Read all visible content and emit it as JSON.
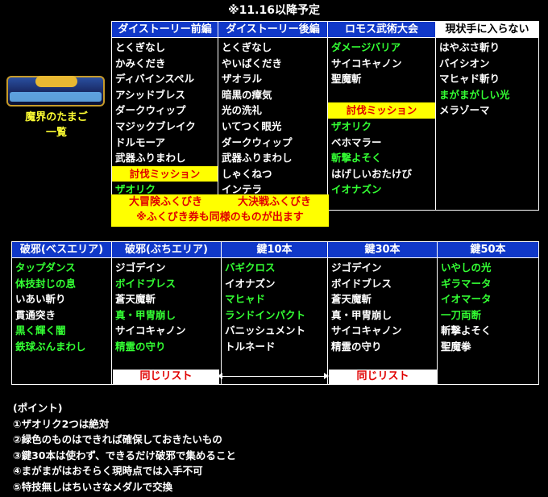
{
  "top_title": "※11.16以降予定",
  "egg_label": [
    "魔界のたまご",
    "一覧"
  ],
  "top_table": {
    "columns": [
      {
        "header": "ダイストーリー前編",
        "header_style": "blue",
        "items": [
          {
            "text": "とくぎなし",
            "c": "w"
          },
          {
            "text": "かみくだき",
            "c": "w"
          },
          {
            "text": "ディバインスペル",
            "c": "w"
          },
          {
            "text": "アシッドブレス",
            "c": "w"
          },
          {
            "text": "ダークウィップ",
            "c": "w"
          },
          {
            "text": "マジックブレイク",
            "c": "w"
          },
          {
            "text": "ドルモーア",
            "c": "w"
          },
          {
            "text": "武器ふりまわし",
            "c": "w"
          },
          {
            "text": "討伐ミッション",
            "c": "bar"
          },
          {
            "text": "ザオリク",
            "c": "g"
          }
        ]
      },
      {
        "header": "ダイストーリー後編",
        "header_style": "blue",
        "items": [
          {
            "text": "とくぎなし",
            "c": "w"
          },
          {
            "text": "やいばくだき",
            "c": "w"
          },
          {
            "text": "ザオラル",
            "c": "w"
          },
          {
            "text": "暗黒の瘴気",
            "c": "w"
          },
          {
            "text": "光の洗礼",
            "c": "w"
          },
          {
            "text": "いてつく眼光",
            "c": "w"
          },
          {
            "text": "ダークウィップ",
            "c": "w"
          },
          {
            "text": "武器ふりまわし",
            "c": "w"
          },
          {
            "text": "しゃくねつ",
            "c": "w"
          },
          {
            "text": "インテラ",
            "c": "w"
          }
        ]
      },
      {
        "header": "ロモス武術大会",
        "header_style": "blue",
        "items": [
          {
            "text": "ダメージバリア",
            "c": "g"
          },
          {
            "text": "サイコキャノン",
            "c": "w"
          },
          {
            "text": "聖魔斬",
            "c": "w"
          },
          {
            "text": "",
            "c": "s"
          },
          {
            "text": "討伐ミッション",
            "c": "bar"
          },
          {
            "text": "ザオリク",
            "c": "g"
          },
          {
            "text": "ベホマラー",
            "c": "w"
          },
          {
            "text": "斬撃よそく",
            "c": "g"
          },
          {
            "text": "はげしいおたけび",
            "c": "w"
          },
          {
            "text": "イオナズン",
            "c": "g"
          }
        ]
      },
      {
        "header": "現状手に入らない",
        "header_style": "white",
        "items": [
          {
            "text": "はやぶさ斬り",
            "c": "w"
          },
          {
            "text": "バイシオン",
            "c": "w"
          },
          {
            "text": "マヒャド斬り",
            "c": "w"
          },
          {
            "text": "まがまがしい光",
            "c": "g"
          },
          {
            "text": "メラゾーマ",
            "c": "w"
          }
        ]
      }
    ]
  },
  "gacha": {
    "left": "大冒険ふくびき",
    "right": "大決戦ふくびき",
    "note": "※ふくびき券も同様のものが出ます"
  },
  "bottom_table": {
    "columns": [
      {
        "header": "破邪(ベスエリア)",
        "items": [
          {
            "text": "タップダンス",
            "c": "g"
          },
          {
            "text": "体技封じの息",
            "c": "g"
          },
          {
            "text": "いあい斬り",
            "c": "w"
          },
          {
            "text": "貫通突き",
            "c": "w"
          },
          {
            "text": "黒く輝く闇",
            "c": "g"
          },
          {
            "text": "鉄球ぶんまわし",
            "c": "g"
          }
        ]
      },
      {
        "header": "破邪(ぶちエリア)",
        "items": [
          {
            "text": "ジゴデイン",
            "c": "w"
          },
          {
            "text": "ボイドブレス",
            "c": "g"
          },
          {
            "text": "蒼天魔斬",
            "c": "w"
          },
          {
            "text": "真・甲冑崩し",
            "c": "g"
          },
          {
            "text": "サイコキャノン",
            "c": "w"
          },
          {
            "text": "精霊の守り",
            "c": "g"
          }
        ]
      },
      {
        "header": "鍵10本",
        "items": [
          {
            "text": "バギクロス",
            "c": "g"
          },
          {
            "text": "イオナズン",
            "c": "w"
          },
          {
            "text": "マヒャド",
            "c": "g"
          },
          {
            "text": "ランドインパクト",
            "c": "g"
          },
          {
            "text": "バニッシュメント",
            "c": "w"
          },
          {
            "text": "トルネード",
            "c": "w"
          }
        ]
      },
      {
        "header": "鍵30本",
        "items": [
          {
            "text": "ジゴデイン",
            "c": "w"
          },
          {
            "text": "ボイドブレス",
            "c": "w"
          },
          {
            "text": "蒼天魔斬",
            "c": "w"
          },
          {
            "text": "真・甲冑崩し",
            "c": "w"
          },
          {
            "text": "サイコキャノン",
            "c": "w"
          },
          {
            "text": "精霊の守り",
            "c": "w"
          }
        ]
      },
      {
        "header": "鍵50本",
        "items": [
          {
            "text": "いやしの光",
            "c": "g"
          },
          {
            "text": "ギラマータ",
            "c": "g"
          },
          {
            "text": "イオマータ",
            "c": "g"
          },
          {
            "text": "一刀両断",
            "c": "g"
          },
          {
            "text": "斬撃よそく",
            "c": "w"
          },
          {
            "text": "聖魔拳",
            "c": "w"
          }
        ]
      }
    ],
    "same_list_label": "同じリスト"
  },
  "notes": [
    "(ポイント)",
    "①ザオリク2つは絶対",
    "②緑色のものはできれば確保しておきたいもの",
    "③鍵30本は使わず、できるだけ破邪で集めること",
    "④まがまがはおそらく現時点では入手不可",
    "⑤特技無しはちいさなメダルで交換"
  ],
  "colors": {
    "header_blue": "#1038c8",
    "green": "#33ff33",
    "yellow": "#ffff00",
    "red": "#e00000"
  }
}
